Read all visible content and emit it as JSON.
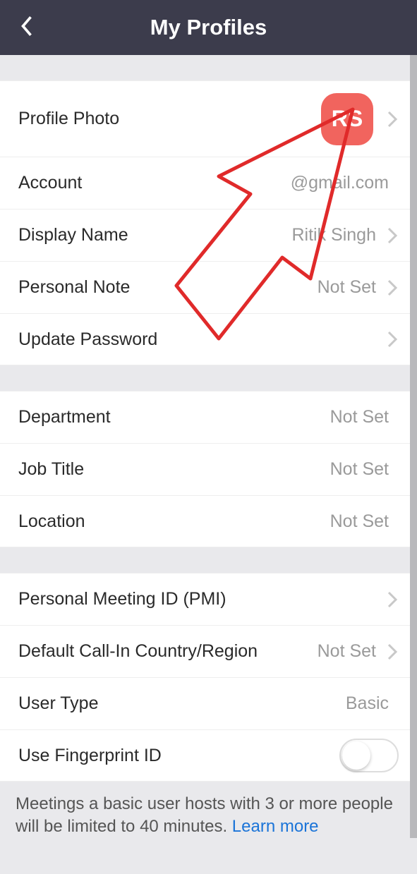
{
  "header": {
    "title": "My Profiles"
  },
  "section1": {
    "profile_photo": {
      "label": "Profile Photo",
      "initials": "RS"
    },
    "account": {
      "label": "Account",
      "value": "@gmail.com"
    },
    "display_name": {
      "label": "Display Name",
      "value": "Ritik Singh"
    },
    "personal_note": {
      "label": "Personal Note",
      "value": "Not Set"
    },
    "update_password": {
      "label": "Update Password"
    }
  },
  "section2": {
    "department": {
      "label": "Department",
      "value": "Not Set"
    },
    "job_title": {
      "label": "Job Title",
      "value": "Not Set"
    },
    "location": {
      "label": "Location",
      "value": "Not Set"
    }
  },
  "section3": {
    "pmi": {
      "label": "Personal Meeting ID (PMI)"
    },
    "callin": {
      "label": "Default Call-In Country/Region",
      "value": "Not Set"
    },
    "user_type": {
      "label": "User Type",
      "value": "Basic"
    },
    "fingerprint": {
      "label": "Use Fingerprint ID"
    }
  },
  "footer": {
    "text": "Meetings a basic user hosts with 3 or more people will be limited to 40 minutes. ",
    "link": "Learn more"
  }
}
